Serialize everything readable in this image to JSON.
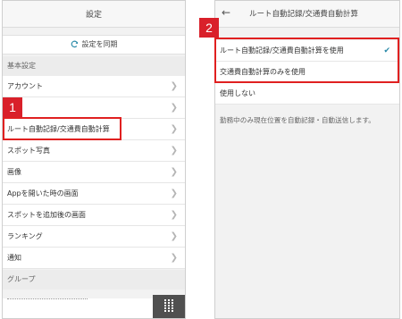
{
  "left": {
    "title": "設定",
    "sync_label": "設定を同期",
    "basic_section": "基本設定",
    "items": [
      "アカウント",
      "",
      "ルート自動記録/交通費自動計算",
      "スポット写真",
      "画像",
      "Appを開いた時の画面",
      "スポットを追加後の画面",
      "ランキング",
      "通知"
    ],
    "group_section": "グループ",
    "badge": "1"
  },
  "right": {
    "title": "ルート自動記録/交通費自動計算",
    "options": [
      "ルート自動記録/交通費自動計算を使用",
      "交通費自動計算のみを使用",
      "使用しない"
    ],
    "description": "勤務中のみ現在位置を自動記録・自動送信します。",
    "badge": "2"
  },
  "colors": {
    "highlight": "#e02020",
    "check": "#2a8aa8"
  },
  "icons": {
    "sync": "sync-icon",
    "chevron": "chevron-right-icon",
    "back": "back-arrow-icon",
    "check": "check-icon",
    "grid": "grid-menu-icon"
  }
}
